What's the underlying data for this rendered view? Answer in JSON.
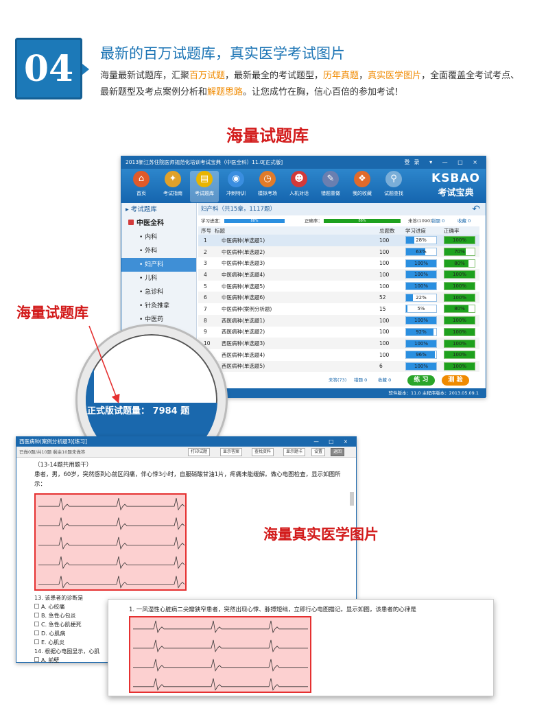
{
  "header": {
    "number": "04",
    "title": "最新的百万试题库，真实医学考试图片",
    "desc_parts": [
      "海量最新试题库，汇聚",
      "百万试题",
      "，最新最全的考试题型，",
      "历年真题",
      "，",
      "真实医学图片",
      "，全面覆盖全考试考点、最新题型及考点案例分析和",
      "解题思路",
      "。让您成竹在胸，信心百倍的参加考试！"
    ]
  },
  "section_title": "海量试题库",
  "app": {
    "title": "2013新江苏住院医师规范化培训考试宝典（中医全科）11.0[正式版]",
    "title_controls": "登录 ▾ — □ ×",
    "toolbar": [
      {
        "label": "首页",
        "icon": "home-icon",
        "glyph": "⌂",
        "color": "#e05a2a"
      },
      {
        "label": "考试指南",
        "icon": "compass-icon",
        "glyph": "✦",
        "color": "#e0a12a"
      },
      {
        "label": "考试题库",
        "icon": "books-icon",
        "glyph": "▤",
        "color": "#e8b400"
      },
      {
        "label": "冲刺特训",
        "icon": "globe-icon",
        "glyph": "◉",
        "color": "#3a8ee0"
      },
      {
        "label": "模拟考场",
        "icon": "clock-icon",
        "glyph": "◷",
        "color": "#e07b2a"
      },
      {
        "label": "人机对话",
        "icon": "chat-icon",
        "glyph": "☻",
        "color": "#d23a3a"
      },
      {
        "label": "错题重做",
        "icon": "flask-icon",
        "glyph": "✎",
        "color": "#6a7fb0"
      },
      {
        "label": "我的收藏",
        "icon": "gift-icon",
        "glyph": "❖",
        "color": "#e06a2a"
      },
      {
        "label": "试题查找",
        "icon": "magnifier-icon",
        "glyph": "⚲",
        "color": "#7aaed8"
      }
    ],
    "brand": {
      "line1": "KSBAO",
      "line2": "考试宝典"
    },
    "sidebar": {
      "header": "▸ 考试题库",
      "category": "中医全科",
      "items": [
        "内科",
        "外科",
        "妇产科",
        "儿科",
        "急诊科",
        "针灸推拿",
        "中医药"
      ]
    },
    "content_header": "妇产科（共15章，1117题）",
    "progress": {
      "study_label": "学习进度：",
      "study_value": "88%",
      "correct_label": "正确率：",
      "correct_value": "88%",
      "unanswered": "未答(1090)",
      "wrong": "错题 0",
      "favorites": "收藏 0"
    },
    "table": {
      "headers": [
        "序号",
        "标题",
        "总题数",
        "学习进度",
        "正确率"
      ],
      "rows": [
        {
          "no": "1",
          "title": "中医病种(单选题1)",
          "total": "100",
          "progress": "28%",
          "pv": 0.28,
          "correct": "100%",
          "cv": 1.0
        },
        {
          "no": "2",
          "title": "中医病种(单选题2)",
          "total": "100",
          "progress": "63%",
          "pv": 0.63,
          "correct": "70%",
          "cv": 0.7
        },
        {
          "no": "3",
          "title": "中医病种(单选题3)",
          "total": "100",
          "progress": "100%",
          "pv": 1.0,
          "correct": "80%",
          "cv": 0.8
        },
        {
          "no": "4",
          "title": "中医病种(单选题4)",
          "total": "100",
          "progress": "100%",
          "pv": 1.0,
          "correct": "100%",
          "cv": 1.0
        },
        {
          "no": "5",
          "title": "中医病种(单选题5)",
          "total": "100",
          "progress": "100%",
          "pv": 1.0,
          "correct": "100%",
          "cv": 1.0
        },
        {
          "no": "6",
          "title": "中医病种(单选题6)",
          "total": "52",
          "progress": "22%",
          "pv": 0.22,
          "correct": "100%",
          "cv": 1.0
        },
        {
          "no": "7",
          "title": "中医病种(案例分析题)",
          "total": "15",
          "progress": "5%",
          "pv": 0.05,
          "correct": "80%",
          "cv": 0.8
        },
        {
          "no": "8",
          "title": "西医病种(单选题1)",
          "total": "100",
          "progress": "100%",
          "pv": 1.0,
          "correct": "100%",
          "cv": 1.0
        },
        {
          "no": "9",
          "title": "西医病种(单选题2)",
          "total": "100",
          "progress": "92%",
          "pv": 0.92,
          "correct": "100%",
          "cv": 1.0
        },
        {
          "no": "10",
          "title": "西医病种(单选题3)",
          "total": "100",
          "progress": "100%",
          "pv": 1.0,
          "correct": "100%",
          "cv": 1.0
        },
        {
          "no": "11",
          "title": "西医病种(单选题4)",
          "total": "100",
          "progress": "96%",
          "pv": 0.96,
          "correct": "100%",
          "cv": 1.0
        },
        {
          "no": "12",
          "title": "西医病种(单选题5)",
          "total": "6",
          "progress": "100%",
          "pv": 1.0,
          "correct": "100%",
          "cv": 1.0
        }
      ]
    },
    "footer": {
      "unanswered": "未答(73)",
      "wrong": "错题 0",
      "favorites": "收藏 0",
      "practice": "练 习",
      "test": "测 验"
    },
    "status": "软件版本：11.0  主程序版本：2013.05.09.1"
  },
  "magnifier_text": "正式版试题量： 7984 题",
  "callout1": "海量试题库",
  "practice": {
    "title": "西医病种(案例分析题3)[练习]",
    "controls": "— □ ×",
    "info": "已做0题/共10题   剩余10题未做答",
    "tools": [
      "打印试题",
      "显示答案",
      "查找资料",
      "显示题卡",
      "设置",
      "返回"
    ],
    "q_intro": "（13-14题共用题干）",
    "q_text": "患者，男，60岁，突然感到心前区闷痛，伴心悸3小时，自服硝酸甘油1片，疼痛未能缓解。做心电图检查，显示如图所示：",
    "q13": "13. 该患者的诊断是",
    "options": [
      "A. 心绞痛",
      "B. 急性心包炎",
      "C. 急性心肌梗死",
      "D. 心肌病",
      "E. 心肌炎"
    ],
    "q14": "14. 根据心电图显示，心肌",
    "opt_a2": "A. 前壁"
  },
  "callout2": "海量真实医学图片",
  "question3": "1. 一风湿性心脏病二尖瓣狭窄患者，突然出现心悸、脉搏短绌，立即行心电图描记。显示如图，该患者的心律是"
}
